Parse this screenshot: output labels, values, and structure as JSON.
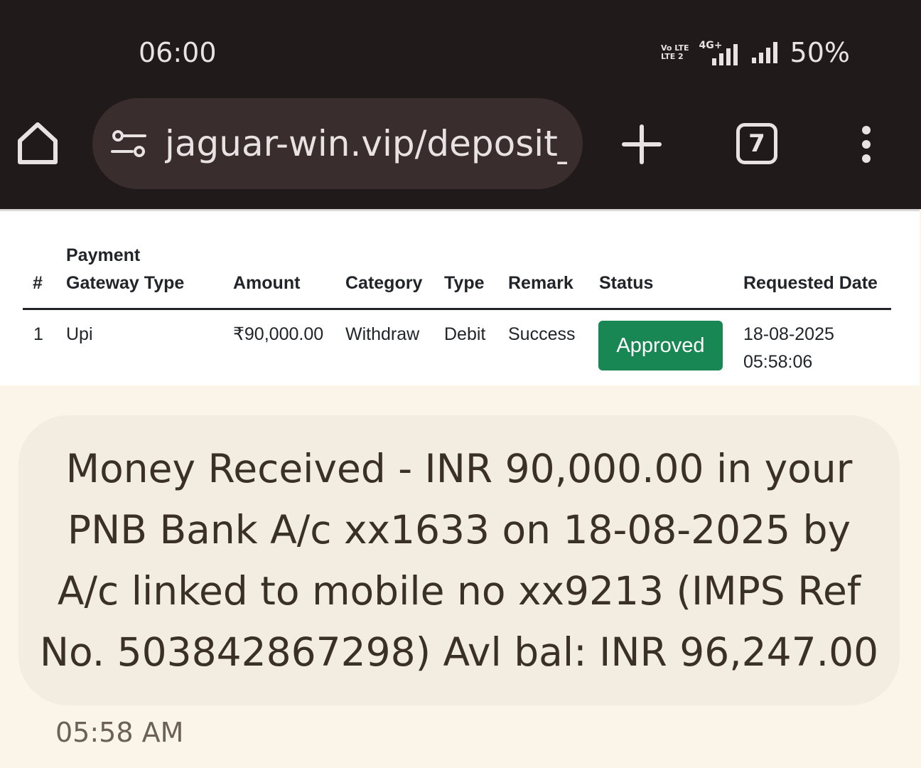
{
  "status_bar": {
    "time": "06:00",
    "volte": "Vo LTE",
    "volte_sub": "LTE 2",
    "network": "4G+",
    "battery": "50%"
  },
  "browser": {
    "url": "jaguar-win.vip/deposit_w",
    "tab_count": "7",
    "icons": [
      "home-icon",
      "site-settings-icon",
      "new-tab-icon",
      "tab-switcher-icon",
      "overflow-menu-icon"
    ]
  },
  "table": {
    "headers": {
      "index": "#",
      "gateway_line1": "Payment",
      "gateway_line2": "Gateway Type",
      "amount": "Amount",
      "category": "Category",
      "type": "Type",
      "remark": "Remark",
      "status": "Status",
      "date": "Requested Date"
    },
    "rows": [
      {
        "index": "1",
        "gateway": "Upi",
        "amount": "₹90,000.00",
        "category": "Withdraw",
        "type": "Debit",
        "remark": "Success",
        "status": "Approved",
        "date": "18-08-2025",
        "time": "05:58:06"
      }
    ],
    "status_color": "#198754"
  },
  "sms": {
    "line1": "Money Received - INR 90,000.00 in your",
    "line2": "PNB Bank A/c xx1633 on 18-08-2025 by",
    "line3": "A/c linked to mobile no xx9213 (IMPS Ref",
    "line4": "No. 503842867298) Avl bal: INR 96,247.00",
    "time": "05:58 AM"
  }
}
